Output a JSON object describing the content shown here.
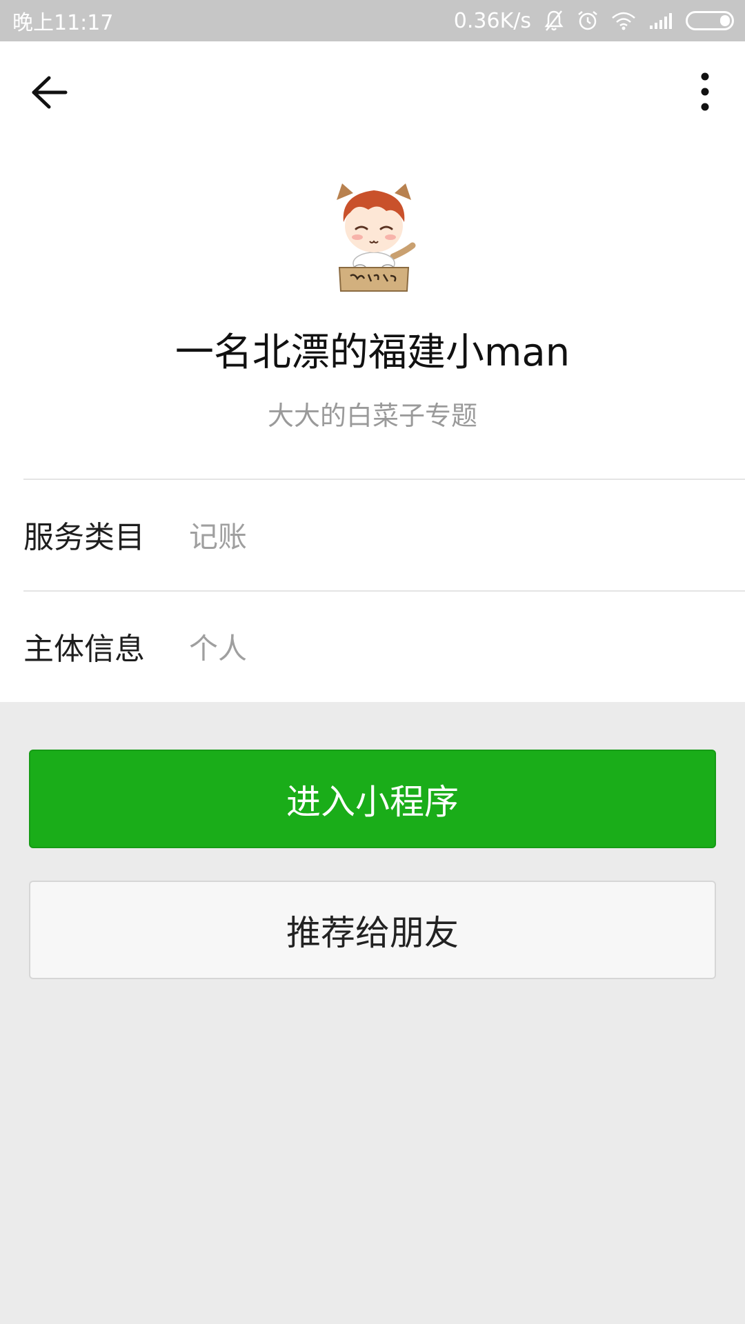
{
  "status_bar": {
    "time": "晚上11:17",
    "network_speed": "0.36K/s",
    "icons": [
      "bell-off-icon",
      "alarm-icon",
      "wifi-icon",
      "signal-icon",
      "battery-icon"
    ]
  },
  "nav": {
    "back_icon": "arrow-left-icon",
    "more_icon": "more-vertical-icon"
  },
  "profile": {
    "name": "一名北漂的福建小man",
    "description": "大大的白菜子专题"
  },
  "info": [
    {
      "label": "服务类目",
      "value": "记账"
    },
    {
      "label": "主体信息",
      "value": "个人"
    }
  ],
  "actions": {
    "enter_label": "进入小程序",
    "share_label": "推荐给朋友"
  },
  "colors": {
    "primary_green": "#1aad19",
    "status_bar": "#c6c6c6",
    "background": "#ebebeb"
  }
}
